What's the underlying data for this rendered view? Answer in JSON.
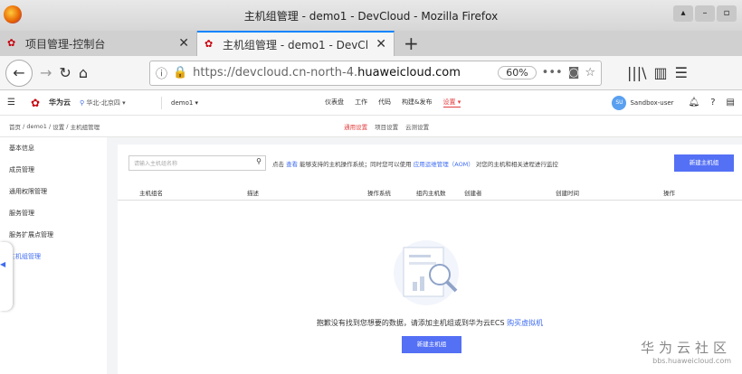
{
  "browser": {
    "title": "主机组管理 - demo1 - DevCloud - Mozilla Firefox",
    "tabs": [
      {
        "label": "项目管理-控制台"
      },
      {
        "label": "主机组管理 - demo1 - DevCl"
      }
    ],
    "url_prefix": "https://devcloud.cn-north-4.",
    "url_domain": "huaweicloud.com",
    "zoom": "60%"
  },
  "header": {
    "brand": "华为云",
    "region": "华北-北京四",
    "project": "demo1",
    "nav": [
      "仪表盘",
      "工作",
      "代码",
      "构建&发布",
      "设置"
    ],
    "user_initials": "SU",
    "user": "Sandbox-user"
  },
  "breadcrumb": [
    "首页",
    "demo1",
    "设置",
    "主机组管理"
  ],
  "subnav": [
    "通用设置",
    "项目设置",
    "云测设置"
  ],
  "sidebar": [
    "基本信息",
    "成员管理",
    "通用权限管理",
    "服务管理",
    "服务扩展点管理",
    "主机组管理"
  ],
  "main": {
    "search_placeholder": "请输入主机组名称",
    "tip_pre": "点击",
    "tip_link1": "查看",
    "tip_mid": "能够支持的主机操作系统；同时您可以使用",
    "tip_link2": "应用运维管理（AOM）",
    "tip_post": "对您的主机和相关进程进行监控",
    "new_button": "新建主机组",
    "columns": [
      "主机组名",
      "描述",
      "操作系统",
      "组内主机数",
      "创建者",
      "创建时间",
      "操作"
    ],
    "empty_text": "抱歉没有找到您想要的数据，请添加主机组或到华为云ECS",
    "empty_link": "购买虚拟机",
    "empty_button": "新建主机组"
  },
  "watermark": {
    "line1": "华为云社区",
    "line2": "bbs.huaweicloud.com"
  }
}
